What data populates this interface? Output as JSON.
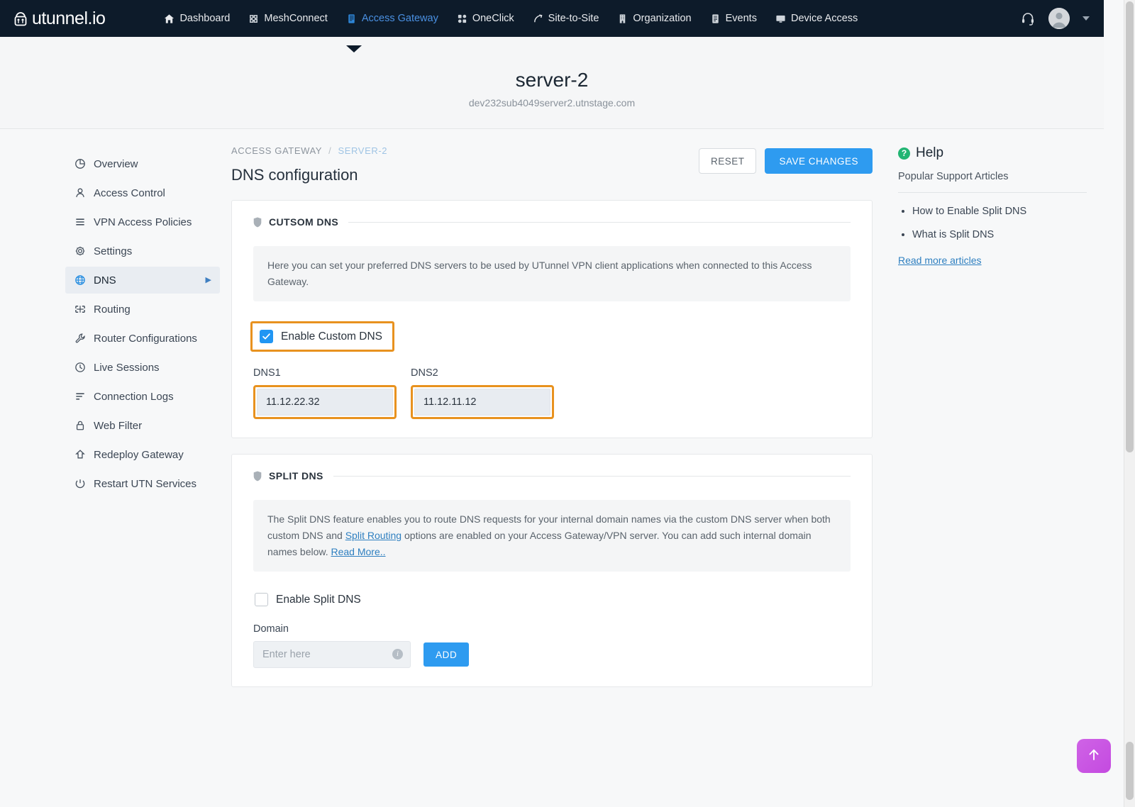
{
  "navbar": {
    "brand": "utunnel.io",
    "brand_icon": "utunnel-lock-logo-icon",
    "items": [
      {
        "label": "Dashboard",
        "icon": "home-icon",
        "active": false
      },
      {
        "label": "MeshConnect",
        "icon": "mesh-nodes-icon",
        "active": false
      },
      {
        "label": "Access Gateway",
        "icon": "server-rack-icon",
        "active": true
      },
      {
        "label": "OneClick",
        "icon": "four-squares-icon",
        "active": false
      },
      {
        "label": "Site-to-Site",
        "icon": "link-arrow-icon",
        "active": false
      },
      {
        "label": "Organization",
        "icon": "building-icon",
        "active": false
      },
      {
        "label": "Events",
        "icon": "list-板-icon",
        "active": false
      },
      {
        "label": "Device Access",
        "icon": "monitor-icon",
        "active": false
      }
    ],
    "support_icon": "headset-icon",
    "avatar_icon": "user-avatar-icon",
    "user_name": "",
    "dropdown_icon": "chevron-down-icon"
  },
  "header": {
    "server_title": "server-2",
    "server_host": "dev232sub4049server2.utnstage.com"
  },
  "sidebar": {
    "items": [
      {
        "label": "Overview",
        "icon": "pie-chart-icon",
        "active": false
      },
      {
        "label": "Access Control",
        "icon": "person-icon",
        "active": false
      },
      {
        "label": "VPN Access Policies",
        "icon": "list-lines-icon",
        "active": false
      },
      {
        "label": "Settings",
        "icon": "gear-icon",
        "active": false
      },
      {
        "label": "DNS",
        "icon": "globe-icon",
        "active": true
      },
      {
        "label": "Routing",
        "icon": "routing-nodes-icon",
        "active": false
      },
      {
        "label": "Router Configurations",
        "icon": "wrench-icon",
        "active": false
      },
      {
        "label": "Live Sessions",
        "icon": "clock-icon",
        "active": false
      },
      {
        "label": "Connection Logs",
        "icon": "logs-icon",
        "active": false
      },
      {
        "label": "Web Filter",
        "icon": "lock-icon",
        "active": false
      },
      {
        "label": "Redeploy Gateway",
        "icon": "up-arrow-box-icon",
        "active": false
      },
      {
        "label": "Restart UTN Services",
        "icon": "restart-icon",
        "active": false
      }
    ],
    "active_arrow_icon": "chevron-right-icon"
  },
  "main": {
    "breadcrumb": {
      "root": "ACCESS GATEWAY",
      "separator": "/",
      "current": "SERVER-2"
    },
    "title": "DNS configuration",
    "reset_label": "RESET",
    "save_label": "SAVE CHANGES",
    "custom_dns": {
      "section_icon": "shield-icon",
      "section_title": "CUTSOM DNS",
      "note": "Here you can set your preferred DNS servers to be used by UTunnel VPN client applications when connected to this Access Gateway.",
      "enable_label": "Enable Custom DNS",
      "enable_checked": true,
      "dns1_label": "DNS1",
      "dns1_value": "11.12.22.32",
      "dns2_label": "DNS2",
      "dns2_value": "11.12.11.12"
    },
    "split_dns": {
      "section_icon": "shield-icon",
      "section_title": "SPLIT DNS",
      "note_part1": "The Split DNS feature enables you to route DNS requests for your internal domain names via the custom DNS server when both custom DNS and ",
      "note_link1": "Split Routing",
      "note_part2": " options are enabled on your Access Gateway/VPN server. You can add such internal domain names below. ",
      "note_link2": "Read More..",
      "enable_label": "Enable Split DNS",
      "enable_checked": false,
      "domain_label": "Domain",
      "domain_value": "",
      "domain_placeholder": "Enter here",
      "domain_info_icon": "info-icon",
      "add_label": "ADD"
    }
  },
  "help": {
    "icon": "question-mark-circle-icon",
    "title": "Help",
    "subtitle": "Popular Support Articles",
    "articles": [
      "How to Enable Split DNS",
      "What is Split DNS"
    ],
    "read_more": "Read more articles"
  },
  "fab": {
    "icon": "arrow-up-icon",
    "color": "#c44ae0"
  },
  "colors": {
    "navbar_bg": "#0d1b2a",
    "accent_blue": "#2e9bf0",
    "active_nav": "#4a90e2",
    "highlight_orange": "#e8921f",
    "help_green": "#22b573",
    "page_bg": "#f7f8f9"
  }
}
